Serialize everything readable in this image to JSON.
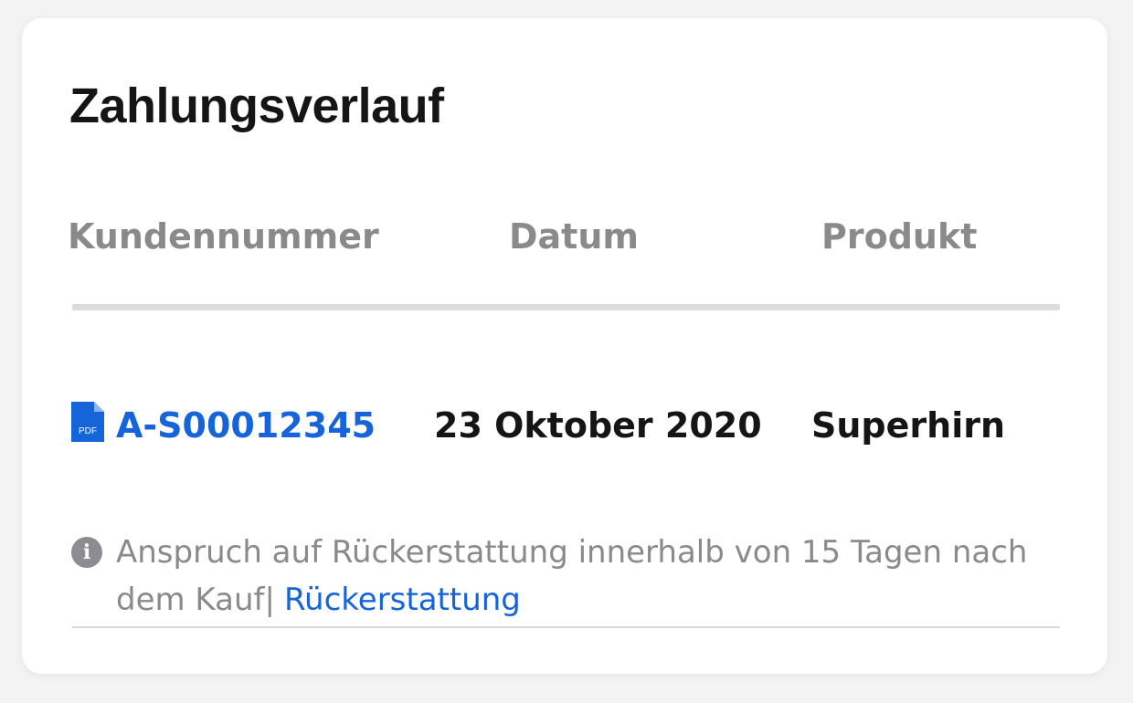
{
  "panel": {
    "title": "Zahlungsverlauf"
  },
  "table": {
    "columns": [
      "Kundennummer",
      "Datum",
      "Produkt"
    ],
    "rows": [
      {
        "customer_number": "A-S00012345",
        "file_icon": "pdf-file-icon",
        "file_icon_label": "PDF",
        "date": "23 Oktober 2020",
        "product": "Superhirn"
      }
    ]
  },
  "refund_note": {
    "icon": "info-icon",
    "icon_glyph": "i",
    "text": "Anspruch auf Rückerstattung innerhalb von 15 Tagen nach dem Kauf",
    "separator": "|",
    "link_label": "Rückerstattung"
  },
  "colors": {
    "link": "#1664d9",
    "muted_text": "#8a8a8d",
    "title_text": "#151515",
    "divider": "#dcdcde"
  }
}
